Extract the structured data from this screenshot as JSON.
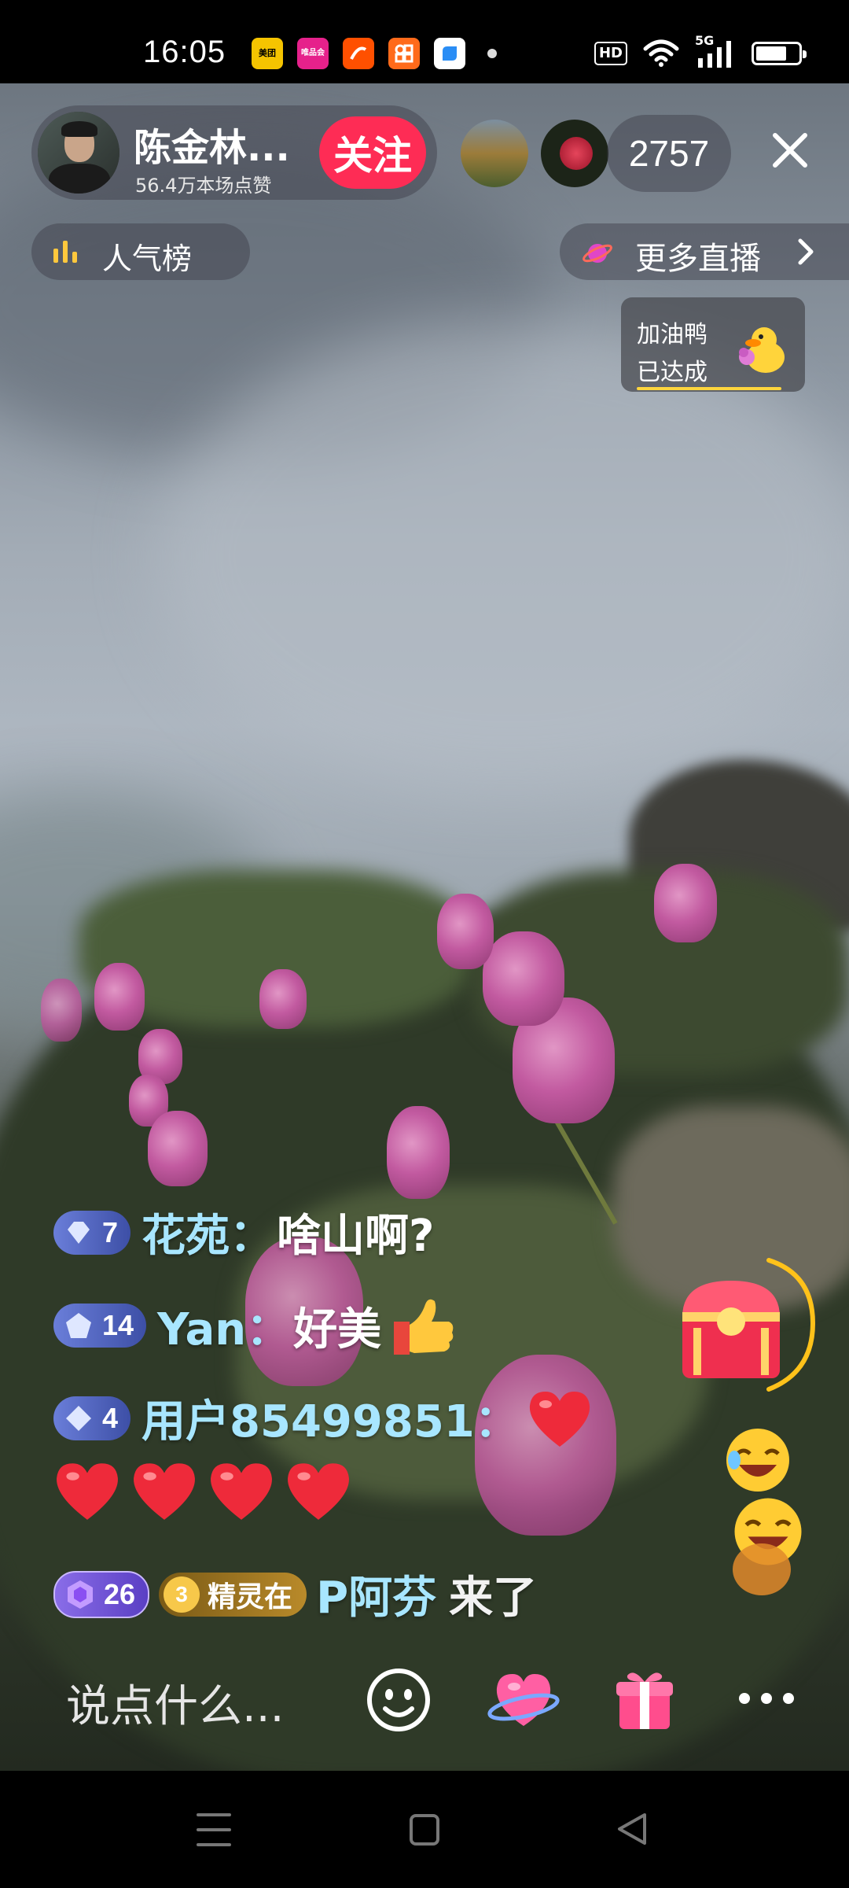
{
  "status_bar": {
    "time": "16:05",
    "app_icons": [
      {
        "name": "meituan-app-icon",
        "text": "美团",
        "color": "#f5c400"
      },
      {
        "name": "vip-app-icon",
        "text": "唯品会",
        "color": "#e6218b"
      },
      {
        "name": "taobao-special-app-icon",
        "text": "",
        "color": "#ff5000"
      },
      {
        "name": "miniapp-icon",
        "text": "",
        "color": "#ff6a1a"
      },
      {
        "name": "blue-app-icon",
        "text": "",
        "color": "#2a8df5"
      }
    ],
    "hd": "HD",
    "network": "5G",
    "battery_level": 0.7
  },
  "anchor": {
    "name": "陈金林...",
    "likes": "56.4万本场点赞",
    "follow_label": "关注"
  },
  "viewer_count": "2757",
  "rank_label": "人气榜",
  "more_live_label": "更多直播",
  "goal": {
    "line1": "加油鸭",
    "line2": "已达成"
  },
  "chat": [
    {
      "level": "7",
      "user": "花苑：",
      "text": "啥山啊?",
      "badge_color": "#4a5db8"
    },
    {
      "level": "14",
      "user": "Yan：",
      "text": "好美",
      "badge_color": "#4a5db8"
    },
    {
      "level": "4",
      "user": "用户85499851：",
      "text": "",
      "badge_color": "#4a5db8"
    }
  ],
  "entry": {
    "level": "26",
    "fan_level": "3",
    "fan_label": "精灵在",
    "user": "P阿芬",
    "action": "来了"
  },
  "input_placeholder": "说点什么...",
  "colors": {
    "follow": "#fe2c55",
    "username": "#a8e6ff",
    "accent_yellow": "#ffd53d"
  }
}
